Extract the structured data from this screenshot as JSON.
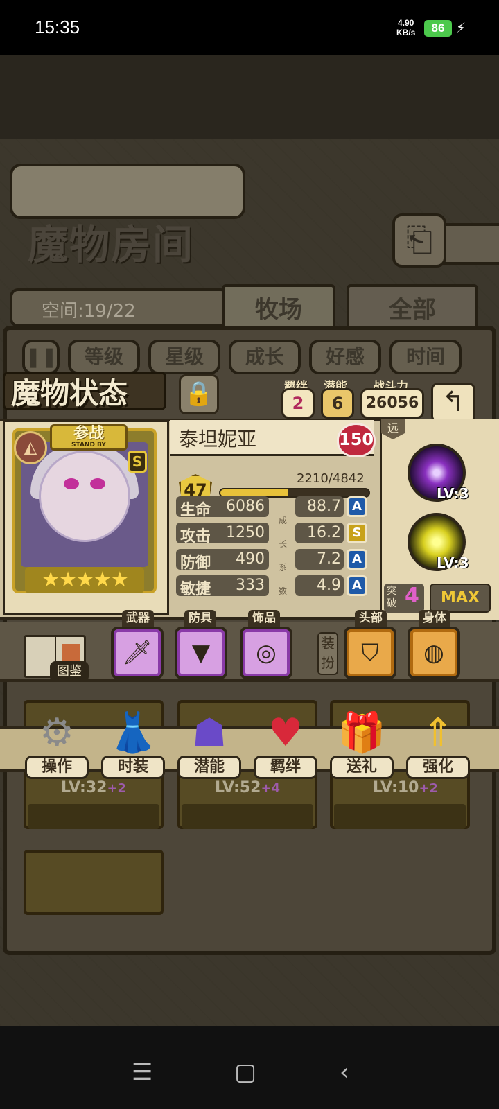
{
  "status_bar": {
    "time": "15:35",
    "speed_value": "4.90",
    "speed_unit": "KB/s",
    "battery": "86",
    "charging_icon": "bolt-icon"
  },
  "room": {
    "title": "魔物房间",
    "back_icon": "return-arrow-icon",
    "space": "空间:19/22",
    "tabs": [
      "牧场",
      "全部"
    ],
    "filter_toggle_icon": "pause-icon",
    "filters": [
      "等级",
      "星级",
      "成长",
      "好感",
      "时间"
    ],
    "cards": [
      {
        "level": "LV:32",
        "plus": "+2"
      },
      {
        "level": "LV:52",
        "plus": "+4"
      },
      {
        "level": "LV:10",
        "plus": "+2"
      }
    ]
  },
  "status": {
    "title": "魔物状态",
    "lock_icon": "lock-icon",
    "bond_label": "羁绊",
    "bond_value": "2",
    "potential_label": "潜能",
    "potential_value": "6",
    "power_label": "战斗力",
    "power_value": "26056",
    "back_icon": "return-arrow-icon"
  },
  "monster": {
    "standby_main": "参战",
    "standby_sub": "STAND BY",
    "rank": "S",
    "stars": 5,
    "name": "泰坦妮亚",
    "affection": "150",
    "level": "47",
    "exp_text": "2210/4842",
    "exp_current": 2210,
    "exp_max": 4842,
    "stats": [
      {
        "name": "生命",
        "value": "6086",
        "growth": "88.7",
        "grade": "A"
      },
      {
        "name": "攻击",
        "value": "1250",
        "growth": "16.2",
        "grade": "S"
      },
      {
        "name": "防御",
        "value": "490",
        "growth": "7.2",
        "grade": "A"
      },
      {
        "name": "敏捷",
        "value": "333",
        "growth": "4.9",
        "grade": "A"
      }
    ],
    "growth_vertical": [
      "成",
      "长",
      "系",
      "数"
    ],
    "range": "远",
    "skills": [
      {
        "level": "LV:3",
        "icon": "dark-burst-icon",
        "color": "#8a30c0"
      },
      {
        "level": "LV:3",
        "icon": "yellow-wave-icon",
        "color": "#d8d020"
      }
    ],
    "breakthrough_label": "突破",
    "breakthrough_value": "4",
    "max_label": "MAX"
  },
  "equipment": {
    "codex_label": "图鉴",
    "costume_label": "装扮",
    "slots": [
      {
        "label": "武器",
        "icon": "sword-icon"
      },
      {
        "label": "防具",
        "icon": "cloak-icon"
      },
      {
        "label": "饰品",
        "icon": "ring-icon"
      },
      {
        "label": "头部",
        "icon": "headband-icon"
      },
      {
        "label": "身体",
        "icon": "pumpkin-icon"
      }
    ]
  },
  "actions": [
    {
      "label": "操作",
      "icon": "gear-icon"
    },
    {
      "label": "时装",
      "icon": "dress-icon"
    },
    {
      "label": "潜能",
      "icon": "demon-icon"
    },
    {
      "label": "羁绊",
      "icon": "hearts-icon"
    },
    {
      "label": "送礼",
      "icon": "gift-icon"
    },
    {
      "label": "强化",
      "icon": "up-arrows-icon"
    }
  ],
  "colors": {
    "grade_a": "#1f5aa8",
    "grade_s": "#c8a21a",
    "break_value": "#e060c8",
    "max_text": "#f0c836"
  }
}
